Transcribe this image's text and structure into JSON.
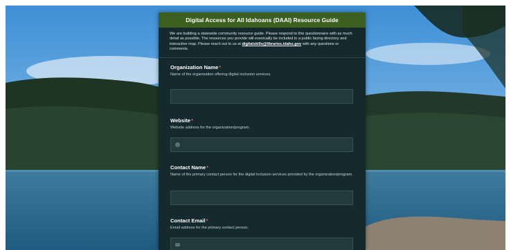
{
  "form": {
    "title": "Digital Access for All Idahoans (DAAI) Resource Guide",
    "intro_text": "We are building a statewide community resource guide. Please respond to this questionnaire with as much detail as possible. The resources you provide will eventually be included in a public facing directory and interactive map. Please reach out to us at",
    "contact_email": "digitalskills@libraries.idaho.gov",
    "intro_suffix": "with any questions or comments.",
    "required_marker": "*",
    "questions": [
      {
        "label": "Organization Name",
        "description": "Name of the organization offering digital inclusion services.",
        "icon": ""
      },
      {
        "label": "Website",
        "description": "Website address for the organization/program.",
        "icon": "globe-icon"
      },
      {
        "label": "Contact Name",
        "description": "Name of the primary contact person for the digital inclusion services provided by the organization/program.",
        "icon": ""
      },
      {
        "label": "Contact Email",
        "description": "Email address for the primary contact person.",
        "icon": "envelope-icon"
      }
    ]
  },
  "colors": {
    "header": "#3b5f1e",
    "card": "#152a2e",
    "required": "#e25a4f"
  }
}
